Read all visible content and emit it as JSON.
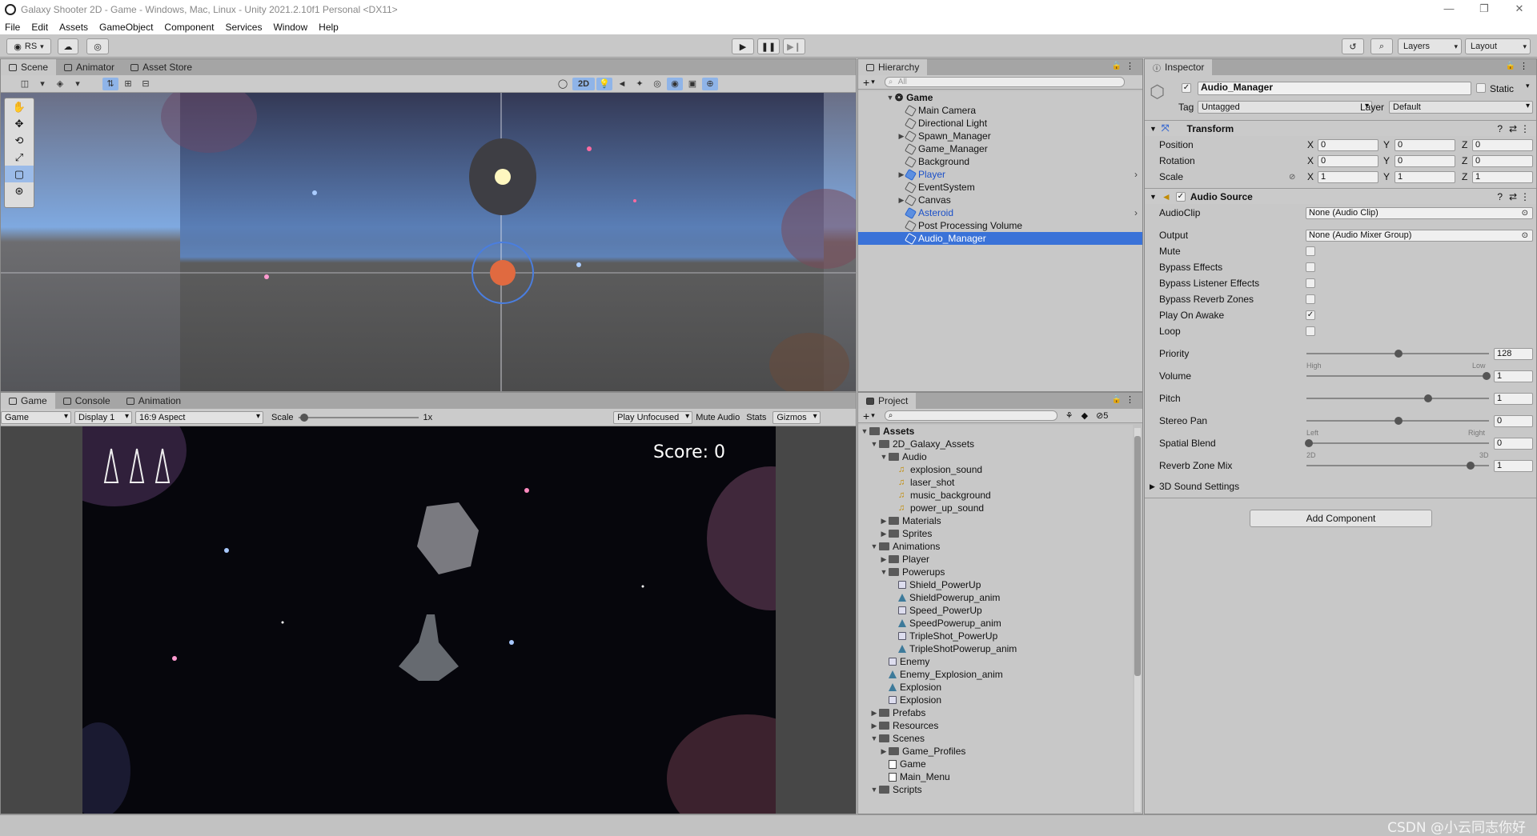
{
  "window": {
    "title": "Galaxy Shooter 2D - Game - Windows, Mac, Linux - Unity 2021.2.10f1 Personal <DX11>"
  },
  "menu": [
    "File",
    "Edit",
    "Assets",
    "GameObject",
    "Component",
    "Services",
    "Window",
    "Help"
  ],
  "toolbar": {
    "account": "RS",
    "layers": "Layers",
    "layout": "Layout"
  },
  "scene_tabs": [
    "Scene",
    "Animator",
    "Asset Store"
  ],
  "scene_toolbar": {
    "mode_2d": "2D"
  },
  "game_tabs": [
    "Game",
    "Console",
    "Animation"
  ],
  "game_toolbar": {
    "display_mode": "Game",
    "display": "Display 1",
    "aspect": "16:9 Aspect",
    "scale_label": "Scale",
    "scale_value": "1x",
    "play_mode": "Play Unfocused",
    "mute": "Mute Audio",
    "stats": "Stats",
    "gizmos": "Gizmos"
  },
  "game_hud": {
    "score": "Score: 0"
  },
  "hierarchy": {
    "tab": "Hierarchy",
    "search_placeholder": "All",
    "root": "Game",
    "items": [
      "Main Camera",
      "Directional Light",
      "Spawn_Manager",
      "Game_Manager",
      "Background",
      "Player",
      "EventSystem",
      "Canvas",
      "Asteroid",
      "Post Processing Volume",
      "Audio_Manager"
    ]
  },
  "project": {
    "tab": "Project",
    "hidden_count": "5",
    "items": [
      "Assets",
      "2D_Galaxy_Assets",
      "Audio",
      "explosion_sound",
      "laser_shot",
      "music_background",
      "power_up_sound",
      "Materials",
      "Sprites",
      "Animations",
      "Player",
      "Powerups",
      "Shield_PowerUp",
      "ShieldPowerup_anim",
      "Speed_PowerUp",
      "SpeedPowerup_anim",
      "TripleShot_PowerUp",
      "TripleShotPowerup_anim",
      "Enemy",
      "Enemy_Explosion_anim",
      "Explosion",
      "Explosion",
      "Prefabs",
      "Resources",
      "Scenes",
      "Game_Profiles",
      "Game",
      "Main_Menu",
      "Scripts"
    ]
  },
  "inspector": {
    "tab": "Inspector",
    "object_name": "Audio_Manager",
    "static_label": "Static",
    "tag_label": "Tag",
    "tag_value": "Untagged",
    "layer_label": "Layer",
    "layer_value": "Default",
    "transform": {
      "title": "Transform",
      "position_label": "Position",
      "rotation_label": "Rotation",
      "scale_label": "Scale",
      "position": [
        "0",
        "0",
        "0"
      ],
      "rotation": [
        "0",
        "0",
        "0"
      ],
      "scale": [
        "1",
        "1",
        "1"
      ]
    },
    "audio": {
      "title": "Audio Source",
      "audioclip_label": "AudioClip",
      "audioclip_value": "None (Audio Clip)",
      "output_label": "Output",
      "output_value": "None (Audio Mixer Group)",
      "mute": "Mute",
      "bypass_effects": "Bypass Effects",
      "bypass_listener": "Bypass Listener Effects",
      "bypass_reverb": "Bypass Reverb Zones",
      "play_on_awake": "Play On Awake",
      "loop": "Loop",
      "priority_label": "Priority",
      "priority_value": "128",
      "priority_high": "High",
      "priority_low": "Low",
      "volume_label": "Volume",
      "volume_value": "1",
      "pitch_label": "Pitch",
      "pitch_value": "1",
      "stereo_label": "Stereo Pan",
      "stereo_value": "0",
      "stereo_left": "Left",
      "stereo_right": "Right",
      "spatial_label": "Spatial Blend",
      "spatial_value": "0",
      "spatial_2d": "2D",
      "spatial_3d": "3D",
      "reverb_label": "Reverb Zone Mix",
      "reverb_value": "1",
      "sound3d_label": "3D Sound Settings"
    },
    "add_component": "Add Component"
  },
  "watermark": "CSDN @小云同志你好"
}
